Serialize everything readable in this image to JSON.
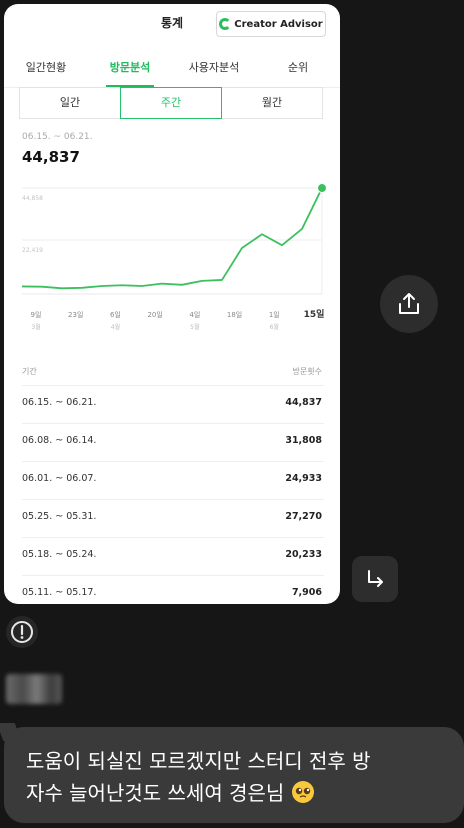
{
  "card": {
    "title": "통계",
    "brand_label": "Creator Advisor",
    "tabs": [
      "일간현황",
      "방문분석",
      "사용자분석",
      "순위"
    ],
    "segments": [
      "일간",
      "주간",
      "월간"
    ],
    "range_label": "06.15. ~ 06.21.",
    "total_value": "44,837"
  },
  "chart_data": {
    "type": "line",
    "y_ticks": [
      "44,858",
      "22,419"
    ],
    "x_labels": [
      "9일",
      "23일",
      "6일",
      "20일",
      "4일",
      "18일",
      "1일",
      "15일"
    ],
    "x_month_labels": [
      "3월",
      "",
      "4월",
      "",
      "5월",
      "",
      "6월",
      ""
    ],
    "values": [
      2400,
      2300,
      1600,
      1800,
      2600,
      2900,
      2600,
      3600,
      3100,
      4800,
      5200,
      19000,
      24900,
      20200,
      27200,
      44837
    ],
    "ylim": [
      0,
      44858
    ],
    "grid": true,
    "accent": "#3cc05f"
  },
  "table": {
    "headers": [
      "기간",
      "방문횟수"
    ],
    "rows": [
      {
        "period": "06.15. ~ 06.21.",
        "count": "44,837"
      },
      {
        "period": "06.08. ~ 06.14.",
        "count": "31,808"
      },
      {
        "period": "06.01. ~ 06.07.",
        "count": "24,933"
      },
      {
        "period": "05.25. ~ 05.31.",
        "count": "27,270"
      },
      {
        "period": "05.18. ~ 05.24.",
        "count": "20,233"
      },
      {
        "period": "05.11. ~ 05.17.",
        "count": "7,906"
      }
    ]
  },
  "chat": {
    "message_line1": "도움이 되실진 모르겠지만 스터디 전후 방",
    "message_line2": "자수 늘어난것도 쓰세여 경은님",
    "icons": {
      "share": "share-icon",
      "reply": "reply-arrow-icon",
      "alert": "alert-icon",
      "emoji": "pleading-face-emoji"
    }
  }
}
